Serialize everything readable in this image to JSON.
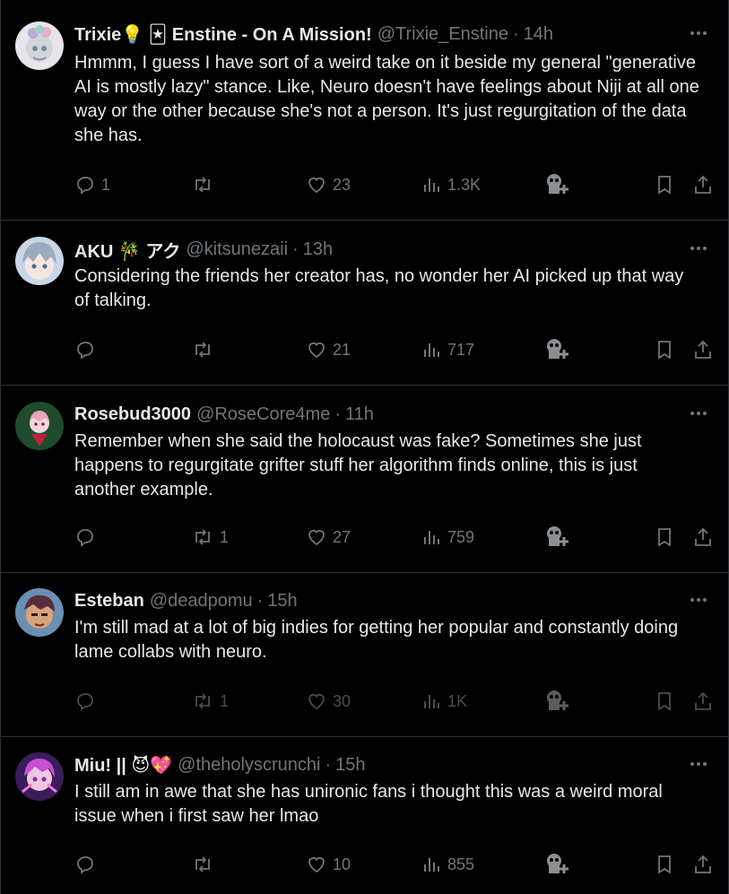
{
  "colors": {
    "background": "#000000",
    "text": "#e7e9ea",
    "muted": "#71767b",
    "divider": "#2f3336"
  },
  "tweets": [
    {
      "name": "Trixie💡 🃏 Enstine - On A Mission!",
      "handle": "@Trixie_Enstine",
      "time": "14h",
      "text": "Hmmm, I guess I have sort of a weird take on it beside my general \"generative AI is mostly lazy\" stance. Like, Neuro doesn't have feelings about Niji at all one way or the other because she's not a person. It's just regurgitation of the data she has.",
      "replies": "1",
      "retweets": "",
      "likes": "23",
      "views": "1.3K",
      "icons": [
        "reply-icon",
        "retweet-icon",
        "like-icon",
        "views-icon",
        "grok-icon",
        "bookmark-icon",
        "share-icon"
      ]
    },
    {
      "name": "AKU 🎋 アク",
      "handle": "@kitsunezaii",
      "time": "13h",
      "text": "Considering the friends her creator has, no wonder her AI picked up that way of talking.",
      "replies": "",
      "retweets": "",
      "likes": "21",
      "views": "717"
    },
    {
      "name": "Rosebud3000",
      "handle": "@RoseCore4me",
      "time": "11h",
      "text": "Remember when she said the holocaust was fake? Sometimes she just happens to regurgitate grifter stuff her algorithm finds online, this is just another example.",
      "replies": "",
      "retweets": "1",
      "likes": "27",
      "views": "759"
    },
    {
      "name": "Esteban",
      "handle": "@deadpomu",
      "time": "15h",
      "text": "I'm still mad at a lot of big indies for getting her popular and constantly doing lame collabs with neuro.",
      "replies": "",
      "retweets": "1",
      "likes": "30",
      "views": "1K"
    },
    {
      "name": "Miu! || 😈💖",
      "handle": "@theholyscrunchi",
      "time": "15h",
      "text": "I still am in awe that she has unironic fans i thought this was a weird moral issue when i first saw her lmao",
      "replies": "",
      "retweets": "",
      "likes": "10",
      "views": "855"
    }
  ],
  "separator": "·"
}
